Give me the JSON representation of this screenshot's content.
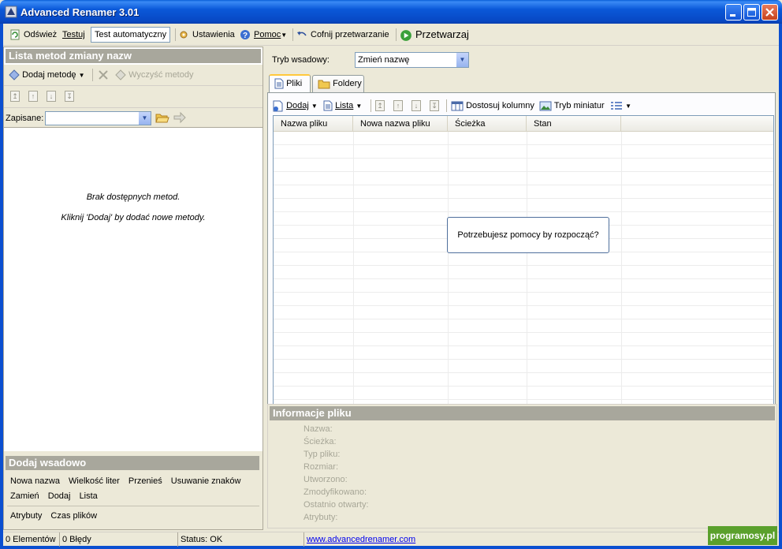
{
  "window": {
    "title": "Advanced Renamer 3.01"
  },
  "toolbar": {
    "refresh": "Odśwież",
    "test": "Testuj",
    "auto_test": "Test automatyczny",
    "settings": "Ustawienia",
    "help": "Pomoc",
    "undo": "Cofnij przetwarzanie",
    "process": "Przetwarzaj"
  },
  "methods_panel": {
    "title": "Lista metod zmiany nazw",
    "add_method": "Dodaj metodę",
    "clear_methods": "Wyczyść metody",
    "saved_label": "Zapisane:",
    "empty_line1": "Brak dostępnych metod.",
    "empty_line2": "Kliknij 'Dodaj' by dodać nowe metody."
  },
  "batch_add": {
    "title": "Dodaj wsadowo",
    "row1": [
      "Nowa nazwa",
      "Wielkość liter",
      "Przenieś",
      "Usuwanie znaków"
    ],
    "row2": [
      "Zamień",
      "Dodaj",
      "Lista"
    ],
    "row3": [
      "Atrybuty",
      "Czas plików"
    ]
  },
  "batch_mode": {
    "label": "Tryb wsadowy:",
    "value": "Zmień nazwę"
  },
  "tabs": {
    "files": "Pliki",
    "folders": "Foldery"
  },
  "files_toolbar": {
    "add": "Dodaj",
    "list": "Lista",
    "columns": "Dostosuj kolumny",
    "thumbnails": "Tryb miniatur"
  },
  "grid": {
    "columns": [
      "Nazwa pliku",
      "Nowa nazwa pliku",
      "Ścieżka",
      "Stan"
    ],
    "help_prompt": "Potrzebujesz pomocy by rozpocząć?"
  },
  "file_info": {
    "title": "Informacje pliku",
    "fields": [
      "Nazwa:",
      "Ścieżka:",
      "Typ pliku:",
      "Rozmiar:",
      "Utworzono:",
      "Zmodyfikowano:",
      "Ostatnio otwarty:",
      "Atrybuty:"
    ]
  },
  "statusbar": {
    "elements": "0 Elementów",
    "errors": "0 Błędy",
    "status": "Status: OK",
    "link": "www.advancedrenamer.com"
  },
  "watermark": "programosy.pl"
}
